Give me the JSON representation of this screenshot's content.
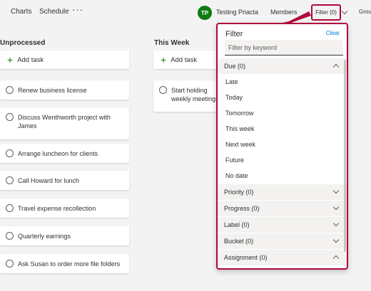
{
  "nav": {
    "tabs": [
      "Charts",
      "Schedule"
    ],
    "more_icon": "ellipsis-icon"
  },
  "user": {
    "initials": "TP",
    "name": "Testing Priacta",
    "avatar_color": "#107c10"
  },
  "header": {
    "members_label": "Members",
    "filter_label": "Filter (0)",
    "group_label": "Grou"
  },
  "columns": [
    {
      "title": "Unprocessed",
      "add_label": "Add task",
      "tasks": [
        "Renew business license",
        "Discuss Wenthworth project with James",
        "Arrange luncheon for clients",
        "Call Howard for lunch",
        "Travel expense recollection",
        "Quarterly earnings",
        "Ask Susan to order more file folders"
      ]
    },
    {
      "title": "This Week",
      "add_label": "Add task",
      "tasks": [
        "Start holding weekly meetings"
      ]
    }
  ],
  "filter_panel": {
    "title": "Filter",
    "clear_label": "Clear",
    "search_placeholder": "Filter by keyword",
    "due_section": "Due (0)",
    "due_options": [
      "Late",
      "Today",
      "Tomorrow",
      "This week",
      "Next week",
      "Future",
      "No date"
    ],
    "sections": [
      "Priority (0)",
      "Progress (0)",
      "Label (0)",
      "Bucket (0)",
      "Assignment (0)"
    ]
  },
  "colors": {
    "highlight": "#b0083a",
    "accent": "#107c10",
    "link": "#0078d4"
  }
}
